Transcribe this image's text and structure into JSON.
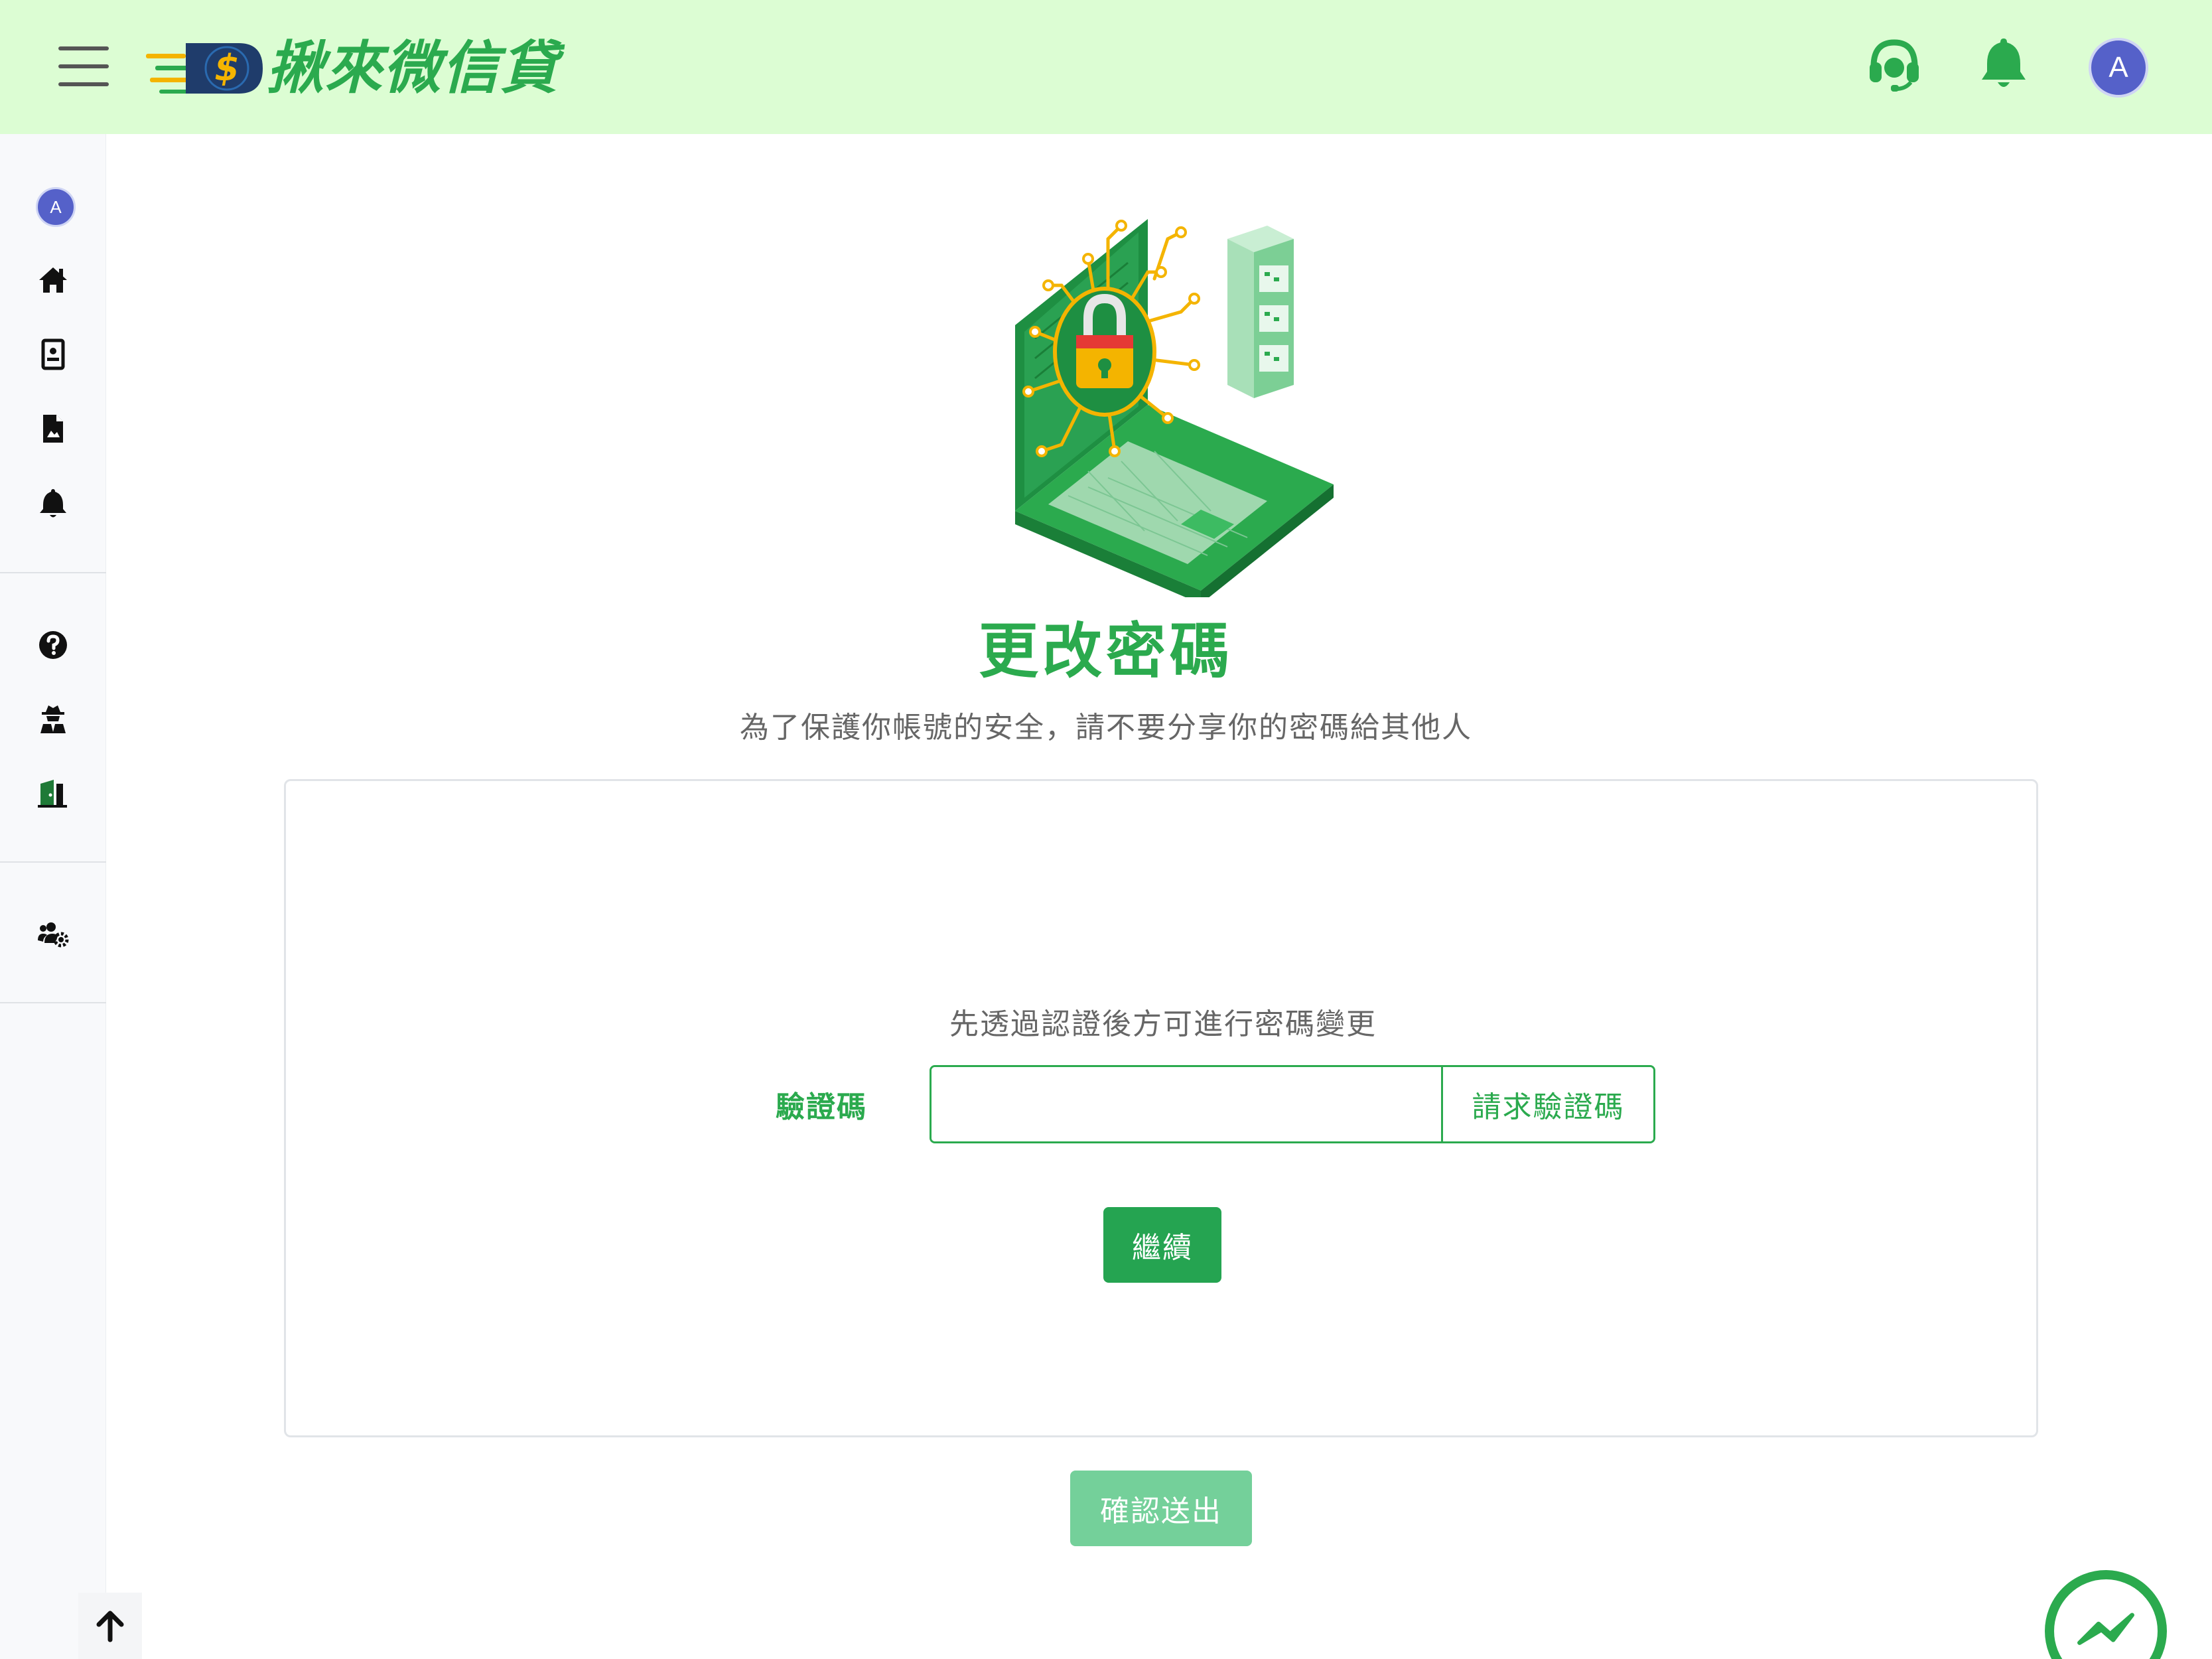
{
  "header": {
    "brand_name": "揪來微信貸",
    "logo_icon": "dollar-coin-logo",
    "avatar_letter": "A",
    "icons": [
      "menu-icon",
      "headset-icon",
      "bell-icon"
    ]
  },
  "sidebar": {
    "avatar_letter": "A",
    "items": [
      {
        "name": "home",
        "icon": "home-icon"
      },
      {
        "name": "profile",
        "icon": "id-card-icon"
      },
      {
        "name": "documents",
        "icon": "file-icon"
      },
      {
        "name": "notifications",
        "icon": "bell-icon"
      },
      {
        "name": "help",
        "icon": "question-circle-icon"
      },
      {
        "name": "security",
        "icon": "user-secret-icon"
      },
      {
        "name": "logout",
        "icon": "door-open-icon"
      },
      {
        "name": "account-settings",
        "icon": "users-cog-icon"
      }
    ]
  },
  "main": {
    "title": "更改密碼",
    "subtitle": "為了保護你帳號的安全，請不要分享你的密碼給其他人",
    "card": {
      "hint": "先透過認證後方可進行密碼變更",
      "code_label": "驗證碼",
      "code_value": "",
      "request_button": "請求驗證碼",
      "continue_button": "繼續"
    },
    "submit_button": "確認送出"
  },
  "colors": {
    "brand_green": "#2baa4e",
    "header_bg": "#dcfdd3",
    "avatar_bg": "#5561c9",
    "submit_disabled": "#74d09a"
  }
}
